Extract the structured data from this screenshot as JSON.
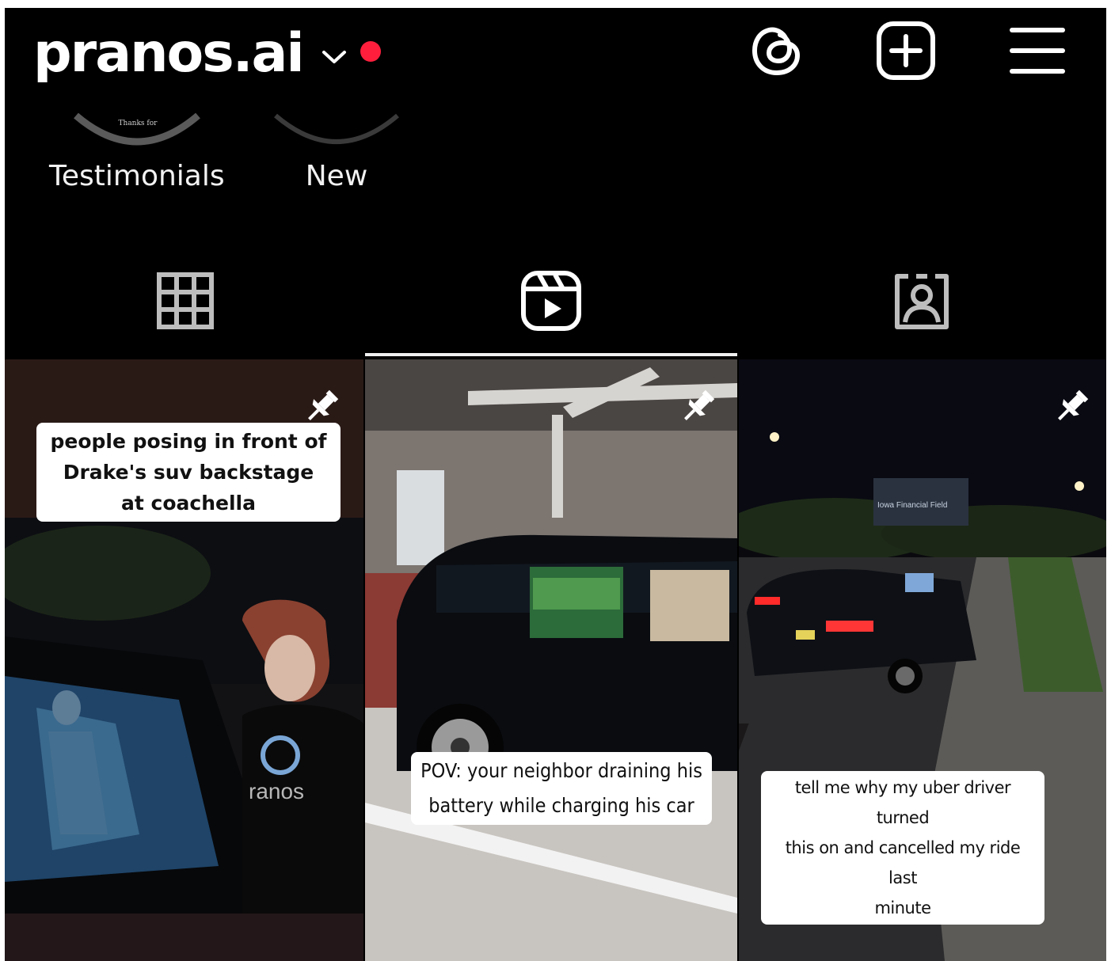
{
  "header": {
    "username": "pranos.ai",
    "notification_dot_color": "#ff1f3d",
    "icons": [
      "threads-icon",
      "create-post-icon",
      "menu-icon"
    ]
  },
  "highlights": [
    {
      "label": "Testimonials",
      "cover_text": "Thanks for"
    },
    {
      "label": "New",
      "cover_text": ""
    }
  ],
  "tabs": [
    {
      "name": "posts-grid",
      "icon": "grid-icon",
      "active": false
    },
    {
      "name": "reels",
      "icon": "reels-icon",
      "active": true
    },
    {
      "name": "tagged",
      "icon": "tagged-icon",
      "active": false
    }
  ],
  "reels": [
    {
      "pinned": true,
      "caption_lines": [
        "people posing in front of",
        "Drake's suv backstage",
        "at coachella"
      ],
      "shirt_text": "ranos"
    },
    {
      "pinned": true,
      "caption_lines": [
        "POV: your neighbor draining his",
        "battery while charging his car"
      ]
    },
    {
      "pinned": true,
      "caption_lines": [
        "tell me why my uber driver turned",
        "this on and cancelled my ride last",
        "minute"
      ],
      "sign_text": "Iowa Financial Field"
    }
  ],
  "colors": {
    "background": "#000000",
    "foreground": "#ffffff",
    "accent": "#ff1f3d"
  }
}
